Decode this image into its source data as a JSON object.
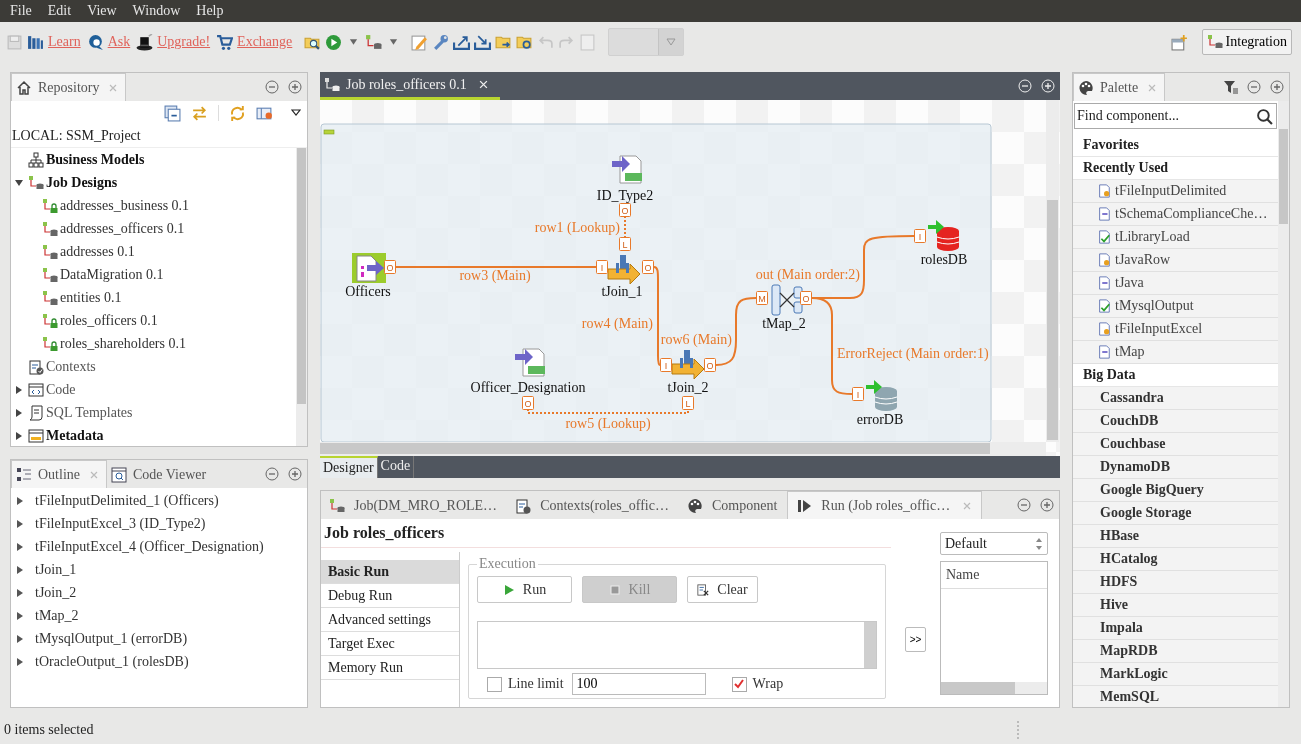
{
  "menu": [
    {
      "label": "File"
    },
    {
      "label": "Edit"
    },
    {
      "label": "View"
    },
    {
      "label": "Window"
    },
    {
      "label": "Help"
    }
  ],
  "toolbar": {
    "links": [
      {
        "label": "Learn"
      },
      {
        "label": "Ask"
      },
      {
        "label": "Upgrade!"
      },
      {
        "label": "Exchange"
      }
    ],
    "perspective": "Integration"
  },
  "repository": {
    "tab": "Repository",
    "project": "LOCAL: SSM_Project",
    "tree": [
      {
        "label": "Business Models",
        "kind": "models",
        "bold": true
      },
      {
        "label": "Job Designs",
        "kind": "jobs",
        "bold": true,
        "expanded": true,
        "children": [
          {
            "label": "addresses_business 0.1",
            "locked": true
          },
          {
            "label": "addresses_officers 0.1",
            "locked": false
          },
          {
            "label": "addresses 0.1",
            "locked": false
          },
          {
            "label": "DataMigration 0.1",
            "locked": false
          },
          {
            "label": "entities 0.1",
            "locked": false
          },
          {
            "label": "roles_officers 0.1",
            "locked": true
          },
          {
            "label": "roles_shareholders 0.1",
            "locked": true
          }
        ]
      },
      {
        "label": "Contexts",
        "kind": "contexts",
        "bold": false
      },
      {
        "label": "Code",
        "kind": "code",
        "bold": false,
        "expanded": false
      },
      {
        "label": "SQL Templates",
        "kind": "sql",
        "bold": false,
        "expanded": false
      },
      {
        "label": "Metadata",
        "kind": "metadata",
        "bold": true,
        "expanded": false
      }
    ]
  },
  "outline": {
    "tabs": [
      {
        "label": "Outline",
        "selected": true
      },
      {
        "label": "Code Viewer",
        "selected": false
      }
    ],
    "items": [
      {
        "label": "tFileInputDelimited_1 (Officers)",
        "expanded": false
      },
      {
        "label": "tFileInputExcel_3 (ID_Type2)",
        "expanded": false
      },
      {
        "label": "tFileInputExcel_4 (Officer_Designation)",
        "expanded": false
      },
      {
        "label": "tJoin_1",
        "expanded": false
      },
      {
        "label": "tJoin_2",
        "expanded": false
      },
      {
        "label": "tMap_2",
        "expanded": false
      },
      {
        "label": "tMysqlOutput_1 (errorDB)",
        "expanded": false
      },
      {
        "label": "tOracleOutput_1 (rolesDB)",
        "expanded": false
      }
    ]
  },
  "editor": {
    "tab": "Job roles_officers 0.1",
    "nodes": [
      {
        "label": "Officers",
        "kind": "delimited_input",
        "highlighted": true
      },
      {
        "label": "ID_Type2",
        "kind": "excel_input",
        "highlighted": false
      },
      {
        "label": "tJoin_1",
        "kind": "join",
        "highlighted": false
      },
      {
        "label": "Officer_Designation",
        "kind": "excel_input",
        "highlighted": false
      },
      {
        "label": "tJoin_2",
        "kind": "join",
        "highlighted": false
      },
      {
        "label": "tMap_2",
        "kind": "map",
        "highlighted": false
      },
      {
        "label": "rolesDB",
        "kind": "oracle_output",
        "highlighted": false
      },
      {
        "label": "errorDB",
        "kind": "mysql_output",
        "highlighted": false
      }
    ],
    "links": [
      {
        "label": "row3 (Main)",
        "kind": "main",
        "source_port": "O",
        "target_port": "I"
      },
      {
        "label": "row1 (Lookup)",
        "kind": "lookup",
        "source_port": "O",
        "target_port": "L"
      },
      {
        "label": "row4 (Main)",
        "kind": "main",
        "source_port": "O",
        "target_port": "I"
      },
      {
        "label": "row5 (Lookup)",
        "kind": "lookup",
        "source_port": "O",
        "target_port": "L"
      },
      {
        "label": "row6 (Main)",
        "kind": "main",
        "source_port": "O",
        "target_port": "M"
      },
      {
        "label": "out (Main order:2)",
        "kind": "main",
        "source_port": "O",
        "target_port": "I"
      },
      {
        "label": "ErrorReject (Main order:1)",
        "kind": "main",
        "target_port": "I"
      }
    ],
    "view_tabs": [
      {
        "label": "Designer",
        "selected": true
      },
      {
        "label": "Code",
        "selected": false
      }
    ]
  },
  "bottom": {
    "tabs": [
      {
        "label": "Job(DM_MRO_ROLE…",
        "selected": false
      },
      {
        "label": "Contexts(roles_offic…",
        "selected": false
      },
      {
        "label": "Component",
        "selected": false
      },
      {
        "label": "Run (Job roles_offic…",
        "selected": true
      }
    ],
    "title": "Job roles_officers",
    "run_modes": [
      {
        "label": "Basic Run",
        "selected": true
      },
      {
        "label": "Debug Run",
        "selected": false
      },
      {
        "label": "Advanced settings",
        "selected": false
      },
      {
        "label": "Target Exec",
        "selected": false
      },
      {
        "label": "Memory Run",
        "selected": false
      }
    ],
    "group": "Execution",
    "buttons": [
      {
        "label": "Run",
        "kind": "run",
        "disabled": false
      },
      {
        "label": "Kill",
        "kind": "kill",
        "disabled": true
      },
      {
        "label": "Clear",
        "kind": "clear",
        "disabled": false
      }
    ],
    "line_limit": {
      "label": "Line limit",
      "checked": false,
      "value": "100"
    },
    "wrap": {
      "label": "Wrap",
      "checked": true
    },
    "move_button": ">>",
    "context": "Default",
    "table_column": "Name"
  },
  "palette": {
    "tab": "Palette",
    "placeholder": "Find component...",
    "items": [
      {
        "label": "Favorites",
        "kind": "header"
      },
      {
        "label": "Recently Used",
        "kind": "header"
      },
      {
        "label": "tFileInputDelimited",
        "kind": "component"
      },
      {
        "label": "tSchemaComplianceChe…",
        "kind": "component"
      },
      {
        "label": "tLibraryLoad",
        "kind": "component"
      },
      {
        "label": "tJavaRow",
        "kind": "component"
      },
      {
        "label": "tJava",
        "kind": "component"
      },
      {
        "label": "tMysqlOutput",
        "kind": "component"
      },
      {
        "label": "tFileInputExcel",
        "kind": "component"
      },
      {
        "label": "tMap",
        "kind": "component"
      },
      {
        "label": "Big Data",
        "kind": "header"
      },
      {
        "label": "Cassandra",
        "kind": "family"
      },
      {
        "label": "CouchDB",
        "kind": "family"
      },
      {
        "label": "Couchbase",
        "kind": "family"
      },
      {
        "label": "DynamoDB",
        "kind": "family"
      },
      {
        "label": "Google BigQuery",
        "kind": "family"
      },
      {
        "label": "Google Storage",
        "kind": "family"
      },
      {
        "label": "HBase",
        "kind": "family"
      },
      {
        "label": "HCatalog",
        "kind": "family"
      },
      {
        "label": "HDFS",
        "kind": "family"
      },
      {
        "label": "Hive",
        "kind": "family"
      },
      {
        "label": "Impala",
        "kind": "family"
      },
      {
        "label": "MapRDB",
        "kind": "family"
      },
      {
        "label": "MarkLogic",
        "kind": "family"
      },
      {
        "label": "MemSQL",
        "kind": "family"
      }
    ]
  },
  "status": "0 items selected"
}
